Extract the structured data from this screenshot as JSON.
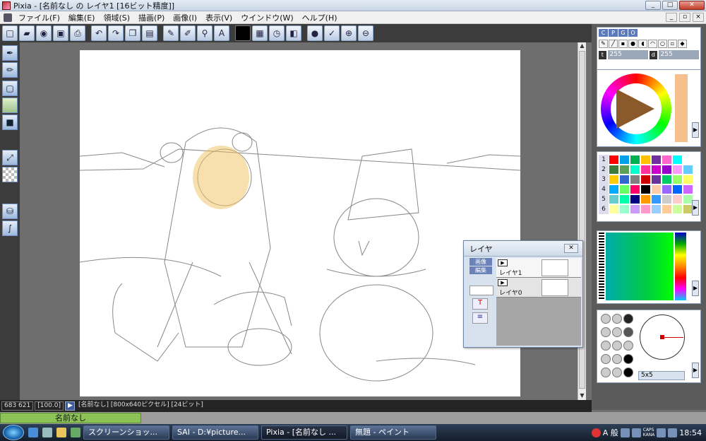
{
  "window": {
    "title": "Pixia - [名前なし の レイヤ1 [16ビット精度]]",
    "controls": {
      "minimize": "_",
      "maximize": "□",
      "close": "✕"
    },
    "mdi_controls": {
      "minimize": "_",
      "restore": "▫",
      "close": "×"
    }
  },
  "menu": {
    "items": [
      {
        "label": "ファイル(F)"
      },
      {
        "label": "編集(E)"
      },
      {
        "label": "領域(S)"
      },
      {
        "label": "描画(P)"
      },
      {
        "label": "画像(I)"
      },
      {
        "label": "表示(V)"
      },
      {
        "label": "ウインドウ(W)"
      },
      {
        "label": "ヘルプ(H)"
      }
    ]
  },
  "layer_window": {
    "title": "レイヤ",
    "close_label": "✕",
    "side_buttons": [
      "画像",
      "編集"
    ],
    "layers": [
      {
        "name": "レイヤ1",
        "visible_marker": "▶",
        "active": true
      },
      {
        "name": "レイヤ0",
        "visible_marker": "▶",
        "active": false
      }
    ]
  },
  "right_panel": {
    "tabs": [
      "C",
      "P",
      "G",
      "O"
    ],
    "t_label": "t",
    "t_value": "255",
    "d_label": "d",
    "d_value": "255",
    "palette_rows": [
      "1",
      "2",
      "3",
      "4",
      "5",
      "6"
    ],
    "brush_size": "5x5"
  },
  "status": {
    "coords": "683 621",
    "zoom": "[100.0]",
    "info": "[名前なし] [800x640ピクセル] [24ビット]"
  },
  "document_tab": {
    "label": "名前なし"
  },
  "taskbar": {
    "tasks": [
      {
        "label": "スクリーンショッ...",
        "active": false
      },
      {
        "label": "SAI - D:¥picture...",
        "active": false
      },
      {
        "label": "Pixia - [名前なし ...",
        "active": true
      },
      {
        "label": "無題 - ペイント",
        "active": false
      }
    ],
    "ime": "A 般",
    "caps": "CAPS",
    "kana": "KANA",
    "clock": "18:54"
  },
  "colors": {
    "accent": "#5d79b9",
    "doc_tab": "#8dc356",
    "taskbar": "#1e2b3d",
    "skin": "#f2c15e"
  },
  "palette_colors": [
    [
      "#ff0000",
      "#00a0e9",
      "#00b050",
      "#ffc000",
      "#7030a0",
      "#ff66cc",
      "#00ffff",
      "#ffffff"
    ],
    [
      "#3c7d3c",
      "#5aa05a",
      "#00ffcc",
      "#ff3399",
      "#cc00cc",
      "#9900cc",
      "#ff99ff",
      "#66ccff"
    ],
    [
      "#ffcc00",
      "#3366cc",
      "#808080",
      "#cc0000",
      "#663399",
      "#00cc66",
      "#99ff66",
      "#ffff66"
    ],
    [
      "#00aaff",
      "#66ff66",
      "#ff0066",
      "#000000",
      "#ffccaa",
      "#9966ff",
      "#0066ff",
      "#cc66ff"
    ],
    [
      "#66cccc",
      "#00ffaa",
      "#000080",
      "#ff9900",
      "#3399ff",
      "#cccccc",
      "#ffcccc",
      "#aaffaa"
    ],
    [
      "#ffff99",
      "#99ffcc",
      "#cc99ff",
      "#ff99cc",
      "#99ccff",
      "#ffcc99",
      "#ccff99",
      "#cccc66"
    ]
  ]
}
